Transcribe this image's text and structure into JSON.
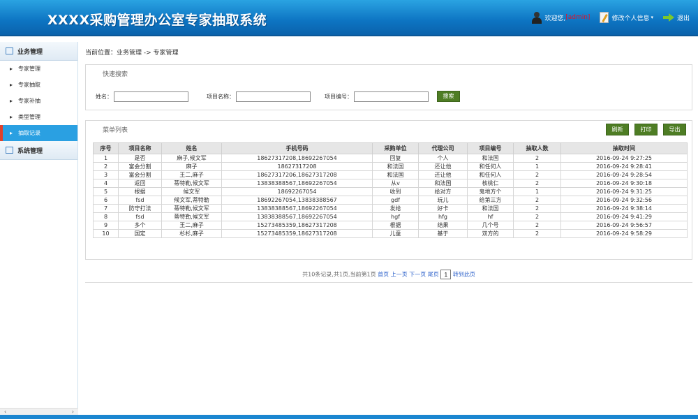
{
  "header": {
    "title": "XXXX采购管理办公室专家抽取系统",
    "welcome_prefix": "欢迎您,",
    "username": "[admin]",
    "edit_profile": "修改个人信息",
    "logout": "退出"
  },
  "sidebar": {
    "group_business": "业务管理",
    "items": [
      {
        "label": "专家管理"
      },
      {
        "label": "专家抽取"
      },
      {
        "label": "专家补抽"
      },
      {
        "label": "类型管理"
      },
      {
        "label": "抽取记录"
      }
    ],
    "group_system": "系统管理"
  },
  "breadcrumb": "当前位置：业务管理 -> 专家管理",
  "search": {
    "title": "快速搜索",
    "name_label": "姓名：",
    "project_name_label": "项目名称：",
    "project_no_label": "项目编号：",
    "button": "搜索"
  },
  "list": {
    "title": "菜单列表",
    "refresh": "刷新",
    "print": "打印",
    "export": "导出",
    "columns": [
      "序号",
      "项目名称",
      "姓名",
      "手机号码",
      "采购单位",
      "代理公司",
      "项目编号",
      "抽取人数",
      "抽取时间"
    ],
    "rows": [
      [
        "1",
        "是否",
        "麻子,候文军",
        "18627317208,18692267054",
        "回复",
        "个人",
        "和法国",
        "2",
        "2016-09-24 9:27:25"
      ],
      [
        "2",
        "富会分割",
        "麻子",
        "18627317208",
        "和法国",
        "还让他",
        "和任何人",
        "1",
        "2016-09-24 9:28:41"
      ],
      [
        "3",
        "富会分割",
        "王二,麻子",
        "18627317206,18627317208",
        "和法国",
        "还让他",
        "和任何人",
        "2",
        "2016-09-24 9:28:54"
      ],
      [
        "4",
        "返回",
        "蒂特勒,候文军",
        "13838388567,18692267054",
        "从v",
        "和法国",
        "核桃仁",
        "2",
        "2016-09-24 9:30:18"
      ],
      [
        "5",
        "根据",
        "候文军",
        "18692267054",
        "收到",
        "给对方",
        "鬼地方个",
        "1",
        "2016-09-24 9:31:25"
      ],
      [
        "6",
        "fsd",
        "候文军,蒂特勒",
        "18692267054,13838388567",
        "gdf",
        "玩儿",
        "给第三方",
        "2",
        "2016-09-24 9:32:56"
      ],
      [
        "7",
        "防守打法",
        "蒂特勒,候文军",
        "13838388567,18692267054",
        "发给",
        "好卡",
        "和法国",
        "2",
        "2016-09-24 9:38:14"
      ],
      [
        "8",
        "fsd",
        "蒂特勒,候文军",
        "13838388567,18692267054",
        "hgf",
        "hfg",
        "hf",
        "2",
        "2016-09-24 9:41:29"
      ],
      [
        "9",
        "多个",
        "王二,麻子",
        "15273485359,18627317208",
        "根据",
        "结果",
        "几个号",
        "2",
        "2016-09-24 9:56:57"
      ],
      [
        "10",
        "国定",
        "杉杉,麻子",
        "15273485359,18627317208",
        "儿童",
        "基于",
        "双方的",
        "2",
        "2016-09-24 9:58:29"
      ]
    ]
  },
  "pager": {
    "summary": "共10条记录,共1页,当前第1页",
    "first": "首页",
    "prev": "上一页",
    "next": "下一页",
    "last": "尾页",
    "page_value": "1",
    "goto": "转到此页"
  }
}
